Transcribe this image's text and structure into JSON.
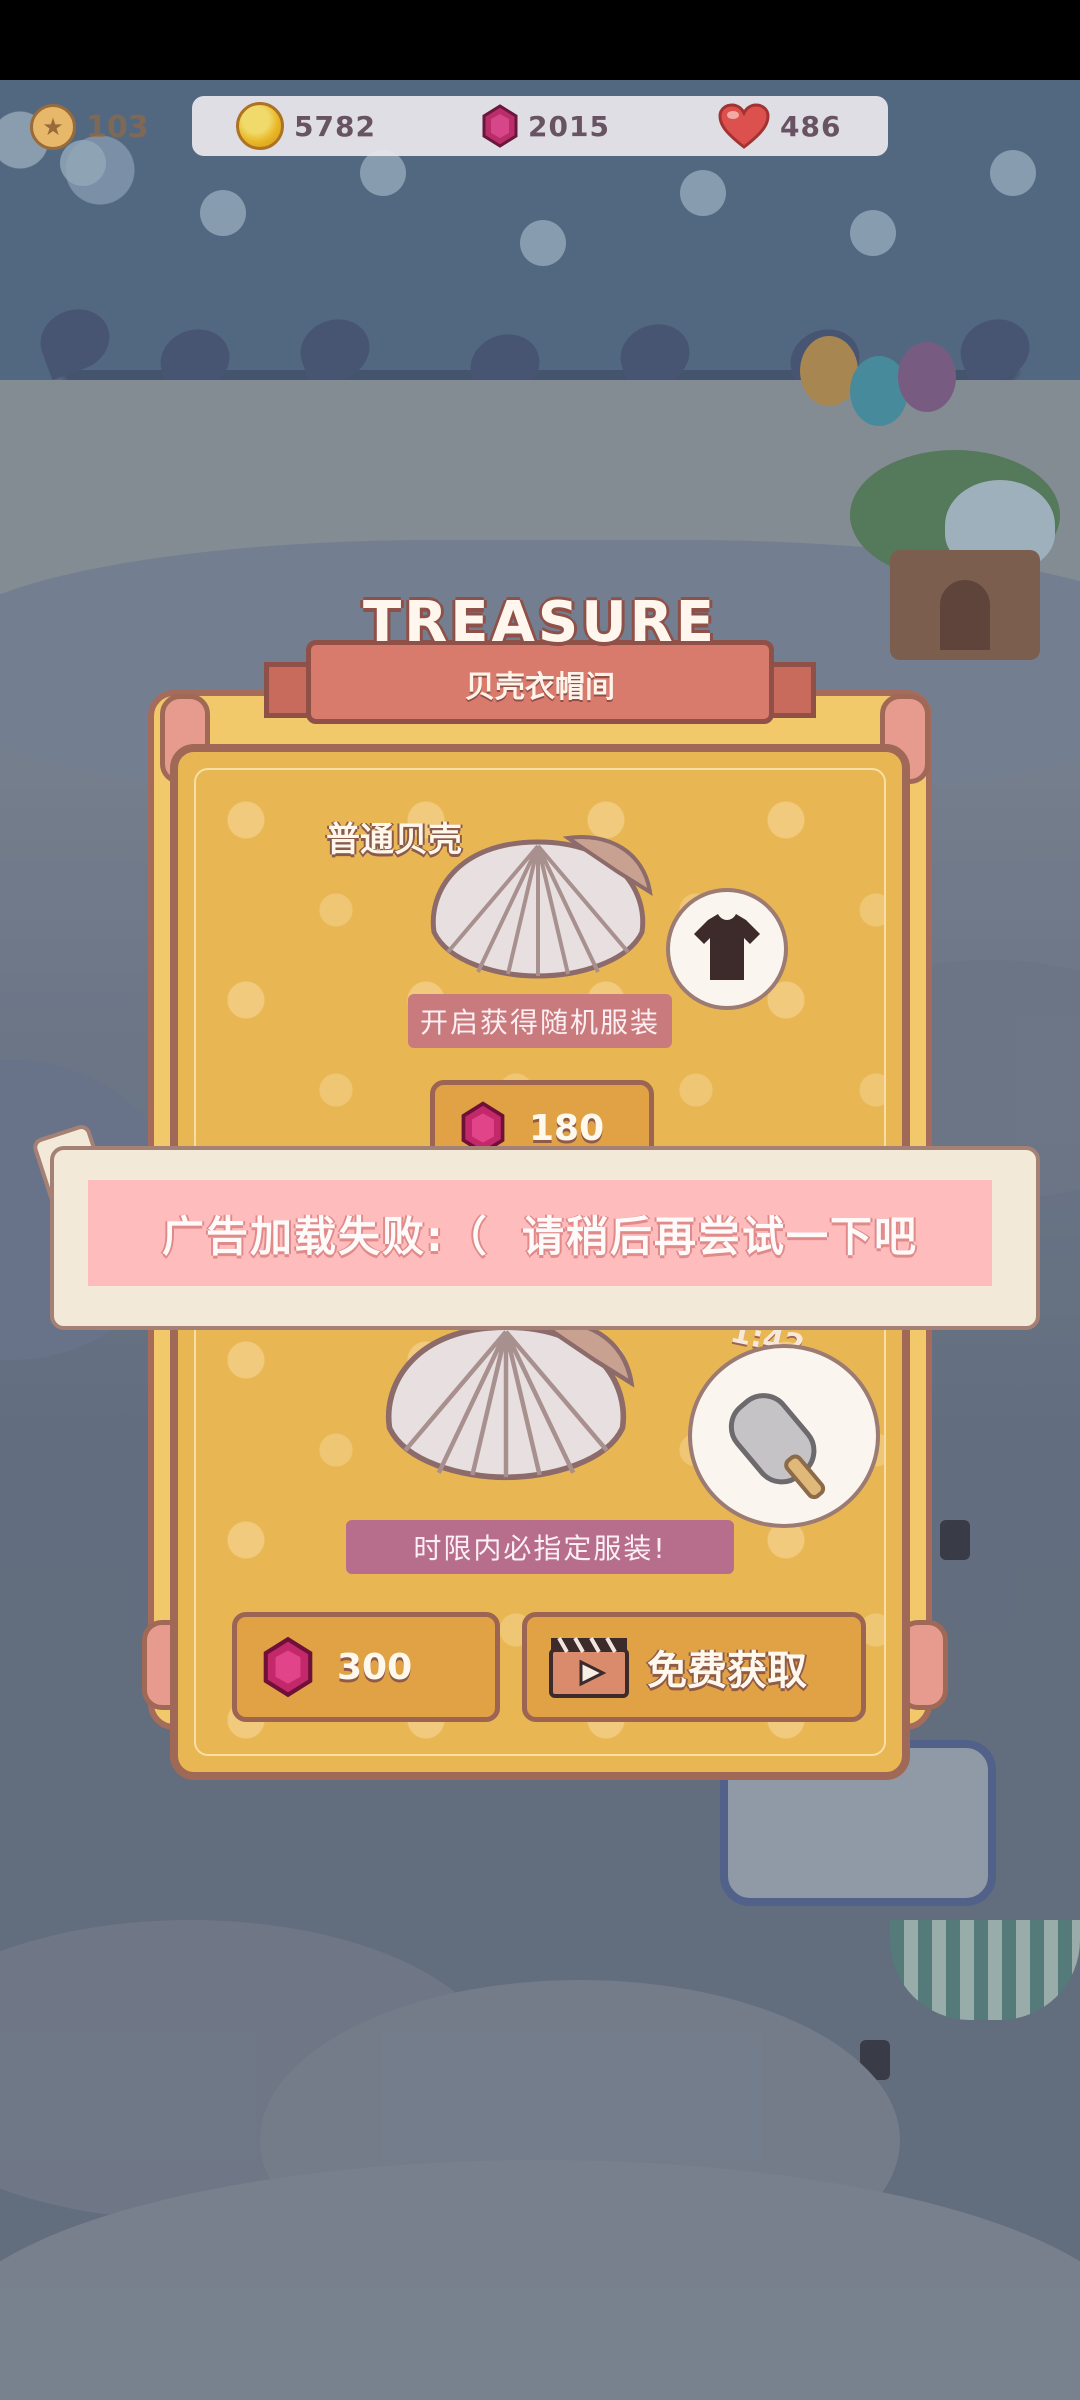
{
  "hud": {
    "level": "103",
    "coins": "5782",
    "gems": "2015",
    "hearts": "486"
  },
  "panel": {
    "title": "TREASURE",
    "subtitle": "贝壳衣帽间",
    "normal_shell": {
      "title": "普通贝壳",
      "desc": "开启获得随机服装",
      "price": "180",
      "bubble_icon": "tshirt-icon"
    },
    "special_shell": {
      "desc": "时限内必指定服装!",
      "price": "300",
      "free_label": "免费获取",
      "bubble_icon": "popsicle-icon",
      "limit_text": "1:42"
    }
  },
  "toast": {
    "message": "广告加载失败:（  请稍后再尝试一下吧"
  },
  "colors": {
    "panel_gold": "#e9b654",
    "panel_border": "#9f6857",
    "toast_band": "#ffbcbc",
    "ribbon": "#d87a6c"
  }
}
